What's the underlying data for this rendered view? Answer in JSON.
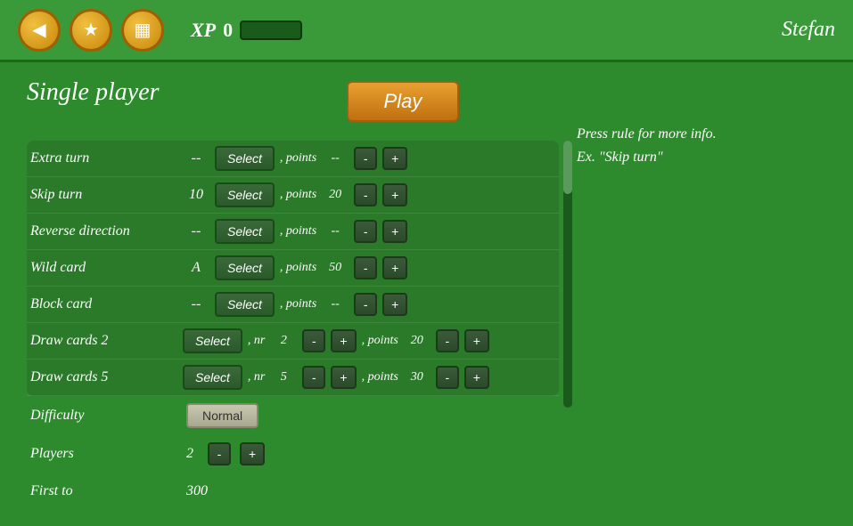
{
  "header": {
    "xp_label": "XP",
    "xp_value": "0",
    "username": "Stefan",
    "icon1": "◀",
    "icon2": "★",
    "icon3": "▦"
  },
  "page": {
    "title": "Single player",
    "play_button": "Play",
    "info_text": "Press rule for more info.\n Ex. \"Skip turn\""
  },
  "rules": [
    {
      "name": "Extra turn",
      "value": "--",
      "select": "Select",
      "points_label": ", points",
      "points_value": "--",
      "has_nr": false
    },
    {
      "name": "Skip turn",
      "value": "10",
      "select": "Select",
      "points_label": ", points",
      "points_value": "20",
      "has_nr": false
    },
    {
      "name": "Reverse direction",
      "value": "--",
      "select": "Select",
      "points_label": ", points",
      "points_value": "--",
      "has_nr": false
    },
    {
      "name": "Wild card",
      "value": "A",
      "select": "Select",
      "points_label": ", points",
      "points_value": "50",
      "has_nr": false
    },
    {
      "name": "Block card",
      "value": "--",
      "select": "Select",
      "points_label": ", points",
      "points_value": "--",
      "has_nr": false
    },
    {
      "name": "Draw cards 2",
      "value": "",
      "select": "Select",
      "points_label": ", points",
      "points_value": "20",
      "has_nr": true,
      "nr_value": "2"
    },
    {
      "name": "Draw cards 5",
      "value": "",
      "select": "Select",
      "points_label": ", points",
      "points_value": "30",
      "has_nr": true,
      "nr_value": "5"
    }
  ],
  "settings": {
    "difficulty_label": "Difficulty",
    "difficulty_value": "Normal",
    "players_label": "Players",
    "players_value": "2",
    "first_to_label": "First to",
    "first_to_value": "300"
  },
  "buttons": {
    "minus": "-",
    "plus": "+"
  }
}
